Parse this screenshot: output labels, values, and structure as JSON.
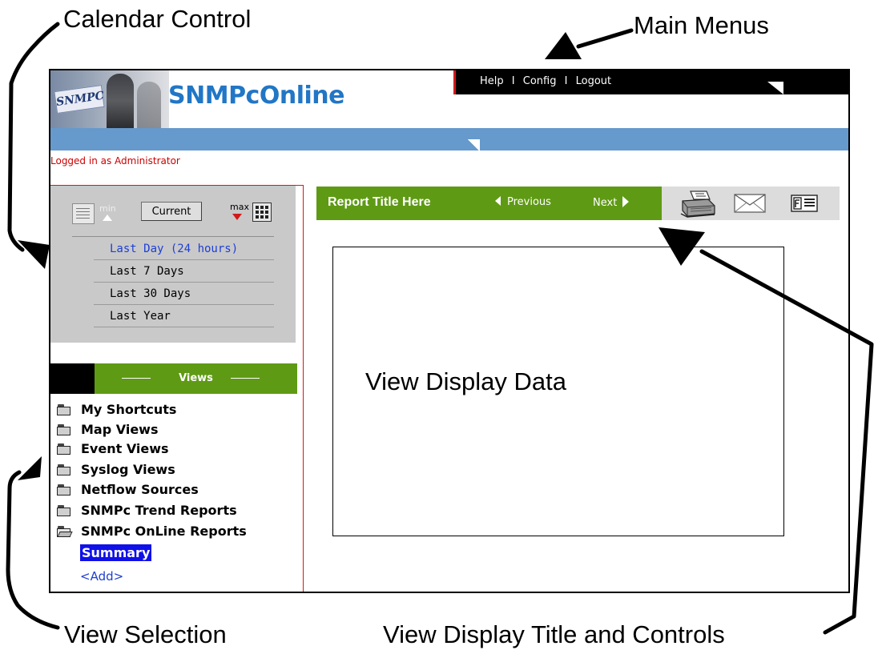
{
  "annotations": {
    "calendar_control": "Calendar Control",
    "main_menus": "Main Menus",
    "view_selection": "View Selection",
    "view_display_title": "View Display Title and Controls"
  },
  "app": {
    "logo_tag": "SNMPC",
    "title": "SNMPcOnline",
    "logged_in": "Logged in as Administrator"
  },
  "menu": {
    "items": [
      "Help",
      "Config",
      "Logout"
    ],
    "separator": "I"
  },
  "calendar": {
    "min_label": "min",
    "max_label": "max",
    "current_button": "Current",
    "ranges": [
      {
        "label": "Last Day (24 hours)",
        "active": true
      },
      {
        "label": "Last 7 Days",
        "active": false
      },
      {
        "label": "Last 30 Days",
        "active": false
      },
      {
        "label": "Last Year",
        "active": false
      }
    ]
  },
  "views": {
    "header": "Views",
    "items": [
      {
        "label": "My Shortcuts",
        "open": false
      },
      {
        "label": "Map Views",
        "open": false
      },
      {
        "label": "Event Views",
        "open": false
      },
      {
        "label": "Syslog Views",
        "open": false
      },
      {
        "label": "Netflow Sources",
        "open": false
      },
      {
        "label": "SNMPc Trend Reports",
        "open": false
      },
      {
        "label": "SNMPc OnLine Reports",
        "open": true
      }
    ],
    "summary": "Summary",
    "add": "<Add>"
  },
  "report": {
    "title": "Report Title Here",
    "previous": "Previous",
    "next": "Next",
    "display_text": "View Display Data"
  },
  "icons": {
    "print": "printer-icon",
    "email": "mail-icon",
    "export": "export-icon",
    "folder": "folder-icon"
  },
  "colors": {
    "brand_blue": "#2176c6",
    "band_blue": "#6699cc",
    "green": "#5f9a14",
    "accent_red": "#d11a1a",
    "link_blue": "#1c3fd6"
  }
}
